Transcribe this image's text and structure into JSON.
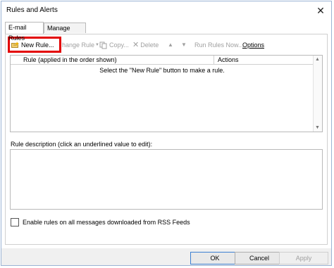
{
  "window": {
    "title": "Rules and Alerts"
  },
  "tabs": [
    {
      "label": "E-mail Rules",
      "active": true
    },
    {
      "label": "Manage Alerts",
      "active": false
    }
  ],
  "toolbar": {
    "new_rule": "New Rule...",
    "change_rule": "hange Rule",
    "copy": "Copy...",
    "delete": "Delete",
    "run_rules_now": "Run Rules Now...",
    "options": "Options"
  },
  "rules_table": {
    "columns": [
      "Rule (applied in the order shown)",
      "Actions"
    ],
    "empty_message": "Select the \"New Rule\" button to make a rule."
  },
  "description": {
    "label": "Rule description (click an underlined value to edit):"
  },
  "rss": {
    "label": "Enable rules on all messages downloaded from RSS Feeds",
    "checked": false
  },
  "buttons": {
    "ok": "OK",
    "cancel": "Cancel",
    "apply": "Apply"
  },
  "colors": {
    "highlight": "#e30000",
    "border": "#9bb3d4"
  }
}
